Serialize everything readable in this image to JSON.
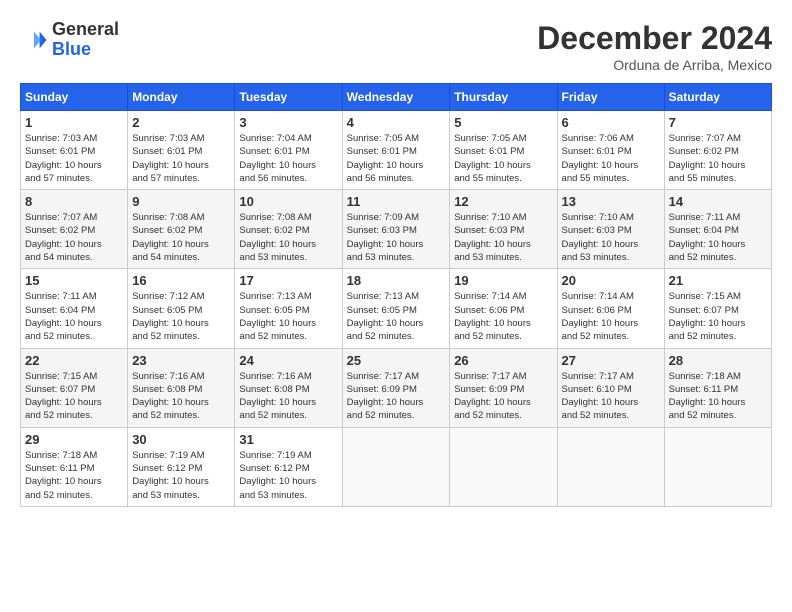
{
  "header": {
    "logo_line1": "General",
    "logo_line2": "Blue",
    "month": "December 2024",
    "location": "Orduna de Arriba, Mexico"
  },
  "weekdays": [
    "Sunday",
    "Monday",
    "Tuesday",
    "Wednesday",
    "Thursday",
    "Friday",
    "Saturday"
  ],
  "weeks": [
    [
      {
        "day": "1",
        "info": "Sunrise: 7:03 AM\nSunset: 6:01 PM\nDaylight: 10 hours\nand 57 minutes."
      },
      {
        "day": "2",
        "info": "Sunrise: 7:03 AM\nSunset: 6:01 PM\nDaylight: 10 hours\nand 57 minutes."
      },
      {
        "day": "3",
        "info": "Sunrise: 7:04 AM\nSunset: 6:01 PM\nDaylight: 10 hours\nand 56 minutes."
      },
      {
        "day": "4",
        "info": "Sunrise: 7:05 AM\nSunset: 6:01 PM\nDaylight: 10 hours\nand 56 minutes."
      },
      {
        "day": "5",
        "info": "Sunrise: 7:05 AM\nSunset: 6:01 PM\nDaylight: 10 hours\nand 55 minutes."
      },
      {
        "day": "6",
        "info": "Sunrise: 7:06 AM\nSunset: 6:01 PM\nDaylight: 10 hours\nand 55 minutes."
      },
      {
        "day": "7",
        "info": "Sunrise: 7:07 AM\nSunset: 6:02 PM\nDaylight: 10 hours\nand 55 minutes."
      }
    ],
    [
      {
        "day": "8",
        "info": "Sunrise: 7:07 AM\nSunset: 6:02 PM\nDaylight: 10 hours\nand 54 minutes."
      },
      {
        "day": "9",
        "info": "Sunrise: 7:08 AM\nSunset: 6:02 PM\nDaylight: 10 hours\nand 54 minutes."
      },
      {
        "day": "10",
        "info": "Sunrise: 7:08 AM\nSunset: 6:02 PM\nDaylight: 10 hours\nand 53 minutes."
      },
      {
        "day": "11",
        "info": "Sunrise: 7:09 AM\nSunset: 6:03 PM\nDaylight: 10 hours\nand 53 minutes."
      },
      {
        "day": "12",
        "info": "Sunrise: 7:10 AM\nSunset: 6:03 PM\nDaylight: 10 hours\nand 53 minutes."
      },
      {
        "day": "13",
        "info": "Sunrise: 7:10 AM\nSunset: 6:03 PM\nDaylight: 10 hours\nand 53 minutes."
      },
      {
        "day": "14",
        "info": "Sunrise: 7:11 AM\nSunset: 6:04 PM\nDaylight: 10 hours\nand 52 minutes."
      }
    ],
    [
      {
        "day": "15",
        "info": "Sunrise: 7:11 AM\nSunset: 6:04 PM\nDaylight: 10 hours\nand 52 minutes."
      },
      {
        "day": "16",
        "info": "Sunrise: 7:12 AM\nSunset: 6:05 PM\nDaylight: 10 hours\nand 52 minutes."
      },
      {
        "day": "17",
        "info": "Sunrise: 7:13 AM\nSunset: 6:05 PM\nDaylight: 10 hours\nand 52 minutes."
      },
      {
        "day": "18",
        "info": "Sunrise: 7:13 AM\nSunset: 6:05 PM\nDaylight: 10 hours\nand 52 minutes."
      },
      {
        "day": "19",
        "info": "Sunrise: 7:14 AM\nSunset: 6:06 PM\nDaylight: 10 hours\nand 52 minutes."
      },
      {
        "day": "20",
        "info": "Sunrise: 7:14 AM\nSunset: 6:06 PM\nDaylight: 10 hours\nand 52 minutes."
      },
      {
        "day": "21",
        "info": "Sunrise: 7:15 AM\nSunset: 6:07 PM\nDaylight: 10 hours\nand 52 minutes."
      }
    ],
    [
      {
        "day": "22",
        "info": "Sunrise: 7:15 AM\nSunset: 6:07 PM\nDaylight: 10 hours\nand 52 minutes."
      },
      {
        "day": "23",
        "info": "Sunrise: 7:16 AM\nSunset: 6:08 PM\nDaylight: 10 hours\nand 52 minutes."
      },
      {
        "day": "24",
        "info": "Sunrise: 7:16 AM\nSunset: 6:08 PM\nDaylight: 10 hours\nand 52 minutes."
      },
      {
        "day": "25",
        "info": "Sunrise: 7:17 AM\nSunset: 6:09 PM\nDaylight: 10 hours\nand 52 minutes."
      },
      {
        "day": "26",
        "info": "Sunrise: 7:17 AM\nSunset: 6:09 PM\nDaylight: 10 hours\nand 52 minutes."
      },
      {
        "day": "27",
        "info": "Sunrise: 7:17 AM\nSunset: 6:10 PM\nDaylight: 10 hours\nand 52 minutes."
      },
      {
        "day": "28",
        "info": "Sunrise: 7:18 AM\nSunset: 6:11 PM\nDaylight: 10 hours\nand 52 minutes."
      }
    ],
    [
      {
        "day": "29",
        "info": "Sunrise: 7:18 AM\nSunset: 6:11 PM\nDaylight: 10 hours\nand 52 minutes."
      },
      {
        "day": "30",
        "info": "Sunrise: 7:19 AM\nSunset: 6:12 PM\nDaylight: 10 hours\nand 53 minutes."
      },
      {
        "day": "31",
        "info": "Sunrise: 7:19 AM\nSunset: 6:12 PM\nDaylight: 10 hours\nand 53 minutes."
      },
      null,
      null,
      null,
      null
    ]
  ]
}
